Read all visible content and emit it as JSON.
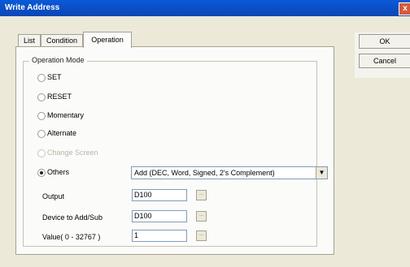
{
  "window": {
    "title": "Write Address",
    "close_glyph": "x"
  },
  "tabs": [
    {
      "label": "List"
    },
    {
      "label": "Condition"
    },
    {
      "label": "Operation"
    }
  ],
  "buttons": {
    "ok": "OK",
    "cancel": "Cancel"
  },
  "operation_mode": {
    "legend": "Operation Mode",
    "options": [
      {
        "label": "SET",
        "selected": false,
        "enabled": true
      },
      {
        "label": "RESET",
        "selected": false,
        "enabled": true
      },
      {
        "label": "Momentary",
        "selected": false,
        "enabled": true
      },
      {
        "label": "Alternate",
        "selected": false,
        "enabled": true
      },
      {
        "label": "Change Screen",
        "selected": false,
        "enabled": false
      },
      {
        "label": "Others",
        "selected": true,
        "enabled": true
      }
    ],
    "others_select": {
      "value": "Add (DEC, Word, Signed, 2's Complement)",
      "arrow": "▼"
    }
  },
  "fields": [
    {
      "label": "Output",
      "value": "D100"
    },
    {
      "label": "Device to Add/Sub",
      "value": "D100"
    },
    {
      "label": "Value( 0 - 32767 )",
      "value": "1"
    }
  ],
  "browse_glyph": "..."
}
